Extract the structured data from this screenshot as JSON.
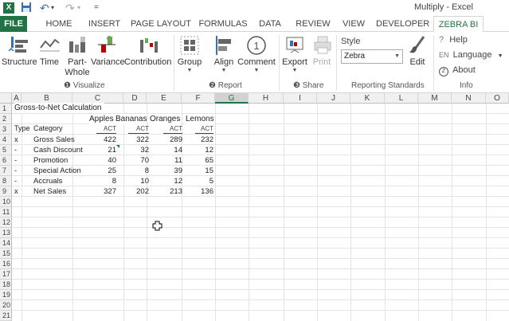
{
  "window": {
    "title": "Multiply - Excel",
    "app_icon": "X"
  },
  "quick_access": {
    "save": "save-icon",
    "undo": "↶",
    "redo": "↷"
  },
  "tabs": [
    "FILE",
    "HOME",
    "INSERT",
    "PAGE LAYOUT",
    "FORMULAS",
    "DATA",
    "REVIEW",
    "VIEW",
    "DEVELOPER",
    "ZEBRA BI"
  ],
  "ribbon": {
    "visualize": {
      "structure": "Structure",
      "time": "Time",
      "part_whole_1": "Part-",
      "part_whole_2": "Whole",
      "variance": "Variance",
      "contribution": "Contribution",
      "group_label": "❶ Visualize"
    },
    "report": {
      "group": "Group",
      "align": "Align",
      "comment": "Comment",
      "group_label": "❷ Report"
    },
    "share": {
      "export": "Export",
      "print": "Print",
      "group_label": "❸ Share"
    },
    "standards": {
      "style_label": "Style",
      "style_value": "Zebra",
      "edit": "Edit",
      "group_label": "Reporting Standards"
    },
    "info": {
      "help": "Help",
      "language": "Language",
      "lang_code": "EN",
      "about": "About",
      "group_label": "Info"
    }
  },
  "columns": [
    "A",
    "B",
    "C",
    "D",
    "E",
    "F",
    "G",
    "H",
    "I",
    "J",
    "K",
    "L",
    "M",
    "N",
    "O"
  ],
  "rows": [
    "1",
    "2",
    "3",
    "4",
    "5",
    "6",
    "7",
    "8",
    "9",
    "10",
    "11",
    "12",
    "13",
    "14",
    "15",
    "16",
    "17",
    "18",
    "19",
    "20",
    "21"
  ],
  "sheet": {
    "title": "Gross-to-Net Calculation",
    "fruits": [
      "Apples",
      "Bananas",
      "Oranges",
      "Lemons"
    ],
    "act": [
      "ACT",
      "ACT",
      "ACT",
      "ACT"
    ],
    "type_header": "Type",
    "category_header": "Category",
    "table": [
      {
        "type": "x",
        "category": "Gross Sales",
        "values": [
          "422",
          "322",
          "289",
          "232"
        ]
      },
      {
        "type": "-",
        "category": "Cash Discount",
        "values": [
          "21",
          "32",
          "14",
          "12"
        ]
      },
      {
        "type": "-",
        "category": "Promotion",
        "values": [
          "40",
          "70",
          "11",
          "65"
        ]
      },
      {
        "type": "-",
        "category": "Special Action",
        "values": [
          "25",
          "8",
          "39",
          "15"
        ]
      },
      {
        "type": "-",
        "category": "Accruals",
        "values": [
          "8",
          "10",
          "12",
          "5"
        ]
      },
      {
        "type": "x",
        "category": "Net Sales",
        "values": [
          "327",
          "202",
          "213",
          "136"
        ]
      }
    ]
  }
}
